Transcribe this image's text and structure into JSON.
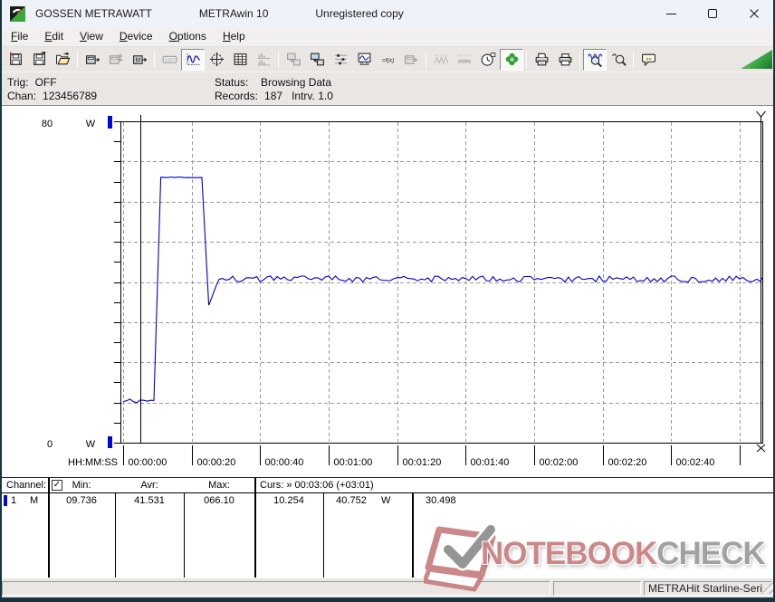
{
  "window": {
    "app_name": "GOSSEN METRAWATT",
    "product_name": "METRAwin 10",
    "license_note": "Unregistered copy"
  },
  "menubar": {
    "items": [
      "File",
      "Edit",
      "View",
      "Device",
      "Options",
      "Help"
    ]
  },
  "toolbar": {
    "groups": [
      [
        {
          "name": "save",
          "state": "normal"
        },
        {
          "name": "save-as",
          "state": "normal"
        },
        {
          "name": "open",
          "state": "normal"
        }
      ],
      [
        {
          "name": "device-read",
          "state": "normal"
        },
        {
          "name": "device-stop",
          "state": "disabled"
        },
        {
          "name": "device-memory",
          "state": "normal"
        }
      ],
      [
        {
          "name": "display",
          "state": "disabled"
        },
        {
          "name": "chart-view",
          "state": "pressed"
        },
        {
          "name": "crosshair",
          "state": "normal"
        },
        {
          "name": "table-view",
          "state": "normal"
        },
        {
          "name": "bar-view",
          "state": "disabled"
        }
      ],
      [
        {
          "name": "export",
          "state": "disabled"
        },
        {
          "name": "import",
          "state": "normal"
        },
        {
          "name": "channels",
          "state": "normal"
        },
        {
          "name": "screen",
          "state": "normal"
        },
        {
          "name": "formula",
          "state": "normal"
        },
        {
          "name": "device-settings",
          "state": "disabled"
        }
      ],
      [
        {
          "name": "wave-low",
          "state": "disabled"
        },
        {
          "name": "wave-dense",
          "state": "disabled"
        },
        {
          "name": "clock",
          "state": "normal"
        },
        {
          "name": "trigger",
          "state": "pressed"
        }
      ],
      [
        {
          "name": "print-preview",
          "state": "normal"
        },
        {
          "name": "print",
          "state": "normal"
        }
      ],
      [
        {
          "name": "zoom-wave",
          "state": "pressed"
        },
        {
          "name": "zoom-cursor",
          "state": "normal"
        }
      ],
      [
        {
          "name": "comment",
          "state": "normal"
        }
      ]
    ]
  },
  "infobar": {
    "trig_label": "Trig:",
    "trig_value": "OFF",
    "chan_label": "Chan:",
    "chan_value": "123456789",
    "status_label": "Status:",
    "status_value": "Browsing Data",
    "records_label": "Records:",
    "records_value": "187",
    "interval_label": "Intrv.",
    "interval_value": "1.0"
  },
  "chart_data": {
    "type": "line",
    "title": "",
    "y_unit": "W",
    "x_axis_label": "HH:MM:SS",
    "ylim": [
      0,
      80
    ],
    "y_top_label": "80",
    "y_bottom_label": "0",
    "y_minor_tick_step_w": 5,
    "y_gridline_step_w": 10,
    "x_tick_interval_s": 20,
    "x_total_s": 187,
    "x_ticks": [
      "00:00:00",
      "00:00:20",
      "00:00:40",
      "00:01:00",
      "00:01:20",
      "00:01:40",
      "00:02:00",
      "00:02:20",
      "00:02:40"
    ],
    "cursor1_s": 5,
    "cursor2_s": 186,
    "line_color": "#0000cc",
    "grid_color": "#9a9a9a",
    "axis_marker_color": "#0008d8",
    "series": [
      {
        "name": "channel-1-power",
        "unit": "W",
        "stats": {
          "min": 9.736,
          "avg": 41.531,
          "max": 66.1,
          "cursor1_value": 10.254,
          "cursor2_value": 40.752,
          "delta": 30.498
        },
        "profile": [
          {
            "type": "flat",
            "from": 0,
            "to": 9,
            "level": 10.3,
            "noise": 0.55
          },
          {
            "type": "ramp",
            "from": 9,
            "to": 11,
            "start": 10.5,
            "end": 66.0
          },
          {
            "type": "flat",
            "from": 11,
            "to": 23,
            "level": 66.05,
            "noise": 0.1
          },
          {
            "type": "ramp",
            "from": 23,
            "to": 25,
            "start": 66.0,
            "end": 34.2
          },
          {
            "type": "ramp",
            "from": 25,
            "to": 28,
            "start": 34.2,
            "end": 40.9
          },
          {
            "type": "flat",
            "from": 28,
            "to": 188,
            "level": 40.75,
            "noise": 0.75
          }
        ]
      }
    ]
  },
  "table": {
    "header": {
      "channel": "Channel:",
      "min": "Min:",
      "avr": "Avr:",
      "max": "Max:",
      "cursor": "Curs: » 00:03:06 (+03:01)",
      "checkbox_checked": true
    },
    "rows": [
      {
        "num": "1",
        "mode": "M",
        "min": "09.736",
        "avr": "41.531",
        "max": "066.10",
        "cursor1": "10.254",
        "cursor2": "40.752",
        "unit": "W",
        "delta": "30.498"
      }
    ]
  },
  "watermark": {
    "word1": "NOTEBOOK",
    "word2": "CHECK",
    "color1": "#c87f81",
    "color2": "#9a9a9a"
  },
  "statusbar": {
    "device_model": "METRAHit Starline-Seri"
  }
}
